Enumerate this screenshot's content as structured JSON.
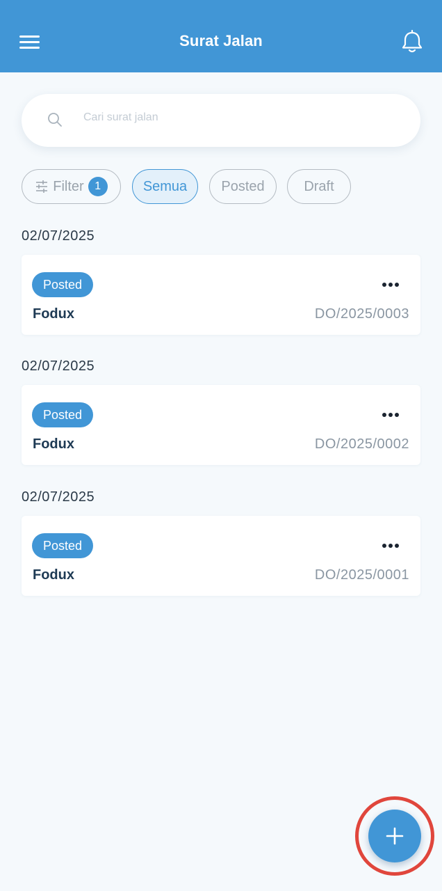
{
  "header": {
    "title": "Surat Jalan",
    "menu_icon": "hamburger-menu-icon",
    "bell_icon": "bell-icon"
  },
  "search": {
    "placeholder": "Cari surat jalan",
    "value": "",
    "icon": "search-icon"
  },
  "filters": {
    "filter_label": "Filter",
    "filter_count": "1",
    "chips": [
      "Semua",
      "Posted",
      "Draft"
    ],
    "active_chip": "Semua"
  },
  "groups": [
    {
      "date": "02/07/2025",
      "status": "Posted",
      "customer": "Fodux",
      "doc_no": "DO/2025/0003"
    },
    {
      "date": "02/07/2025",
      "status": "Posted",
      "customer": "Fodux",
      "doc_no": "DO/2025/0002"
    },
    {
      "date": "02/07/2025",
      "status": "Posted",
      "customer": "Fodux",
      "doc_no": "DO/2025/0001"
    }
  ],
  "fab": {
    "icon": "plus-icon"
  },
  "colors": {
    "primary": "#4196d6",
    "background": "#f5f9fc",
    "highlight_ring": "#e0463c"
  }
}
